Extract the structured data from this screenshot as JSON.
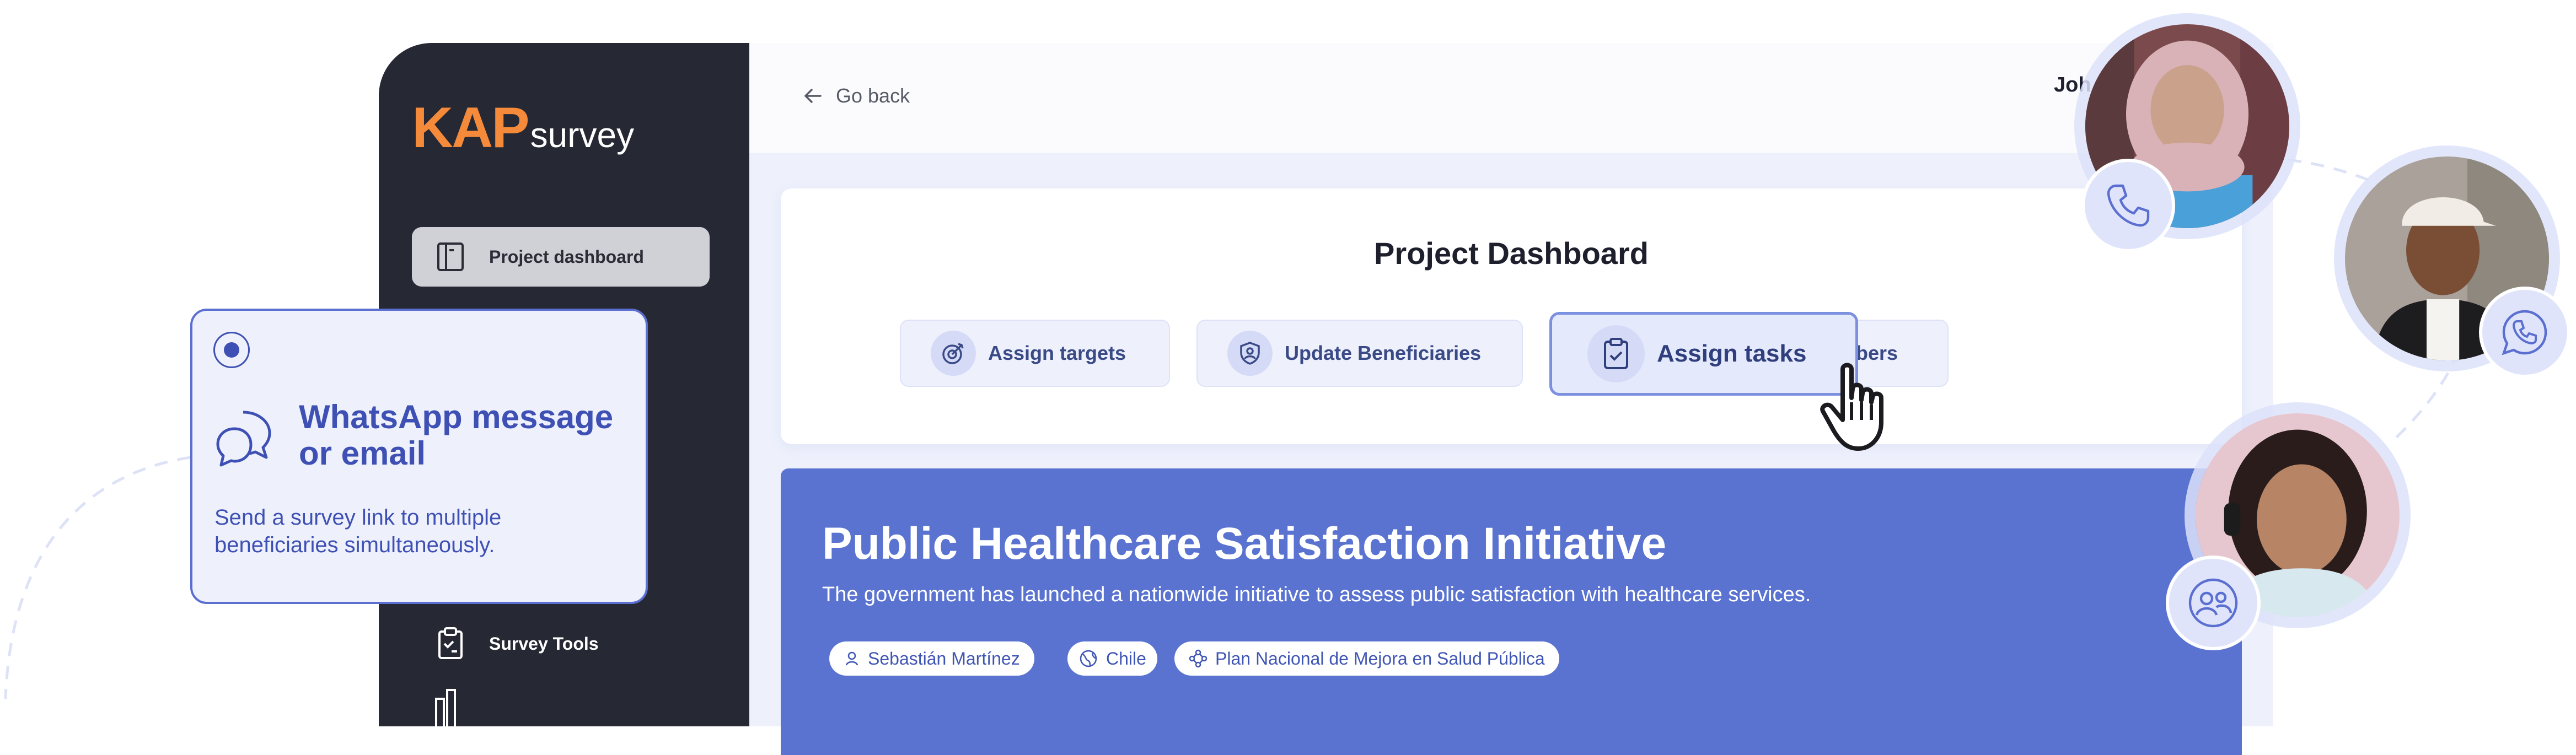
{
  "brand": {
    "kap": "KAP",
    "survey": "survey"
  },
  "sidebar": {
    "items": [
      {
        "label": "Project dashboard",
        "icon": "notebook-icon",
        "active": true
      },
      {
        "label": "Survey Tools",
        "icon": "clipboard-icon",
        "active": false
      }
    ]
  },
  "topbar": {
    "go_back": "Go back",
    "user": "Joh"
  },
  "dashboard": {
    "title": "Project Dashboard",
    "actions": [
      {
        "label": "Assign targets",
        "icon": "target-icon"
      },
      {
        "label": "Update Beneficiaries",
        "icon": "shield-user-icon"
      },
      {
        "label": "Assign tasks",
        "icon": "clipboard-check-icon",
        "highlighted": true
      },
      {
        "label": "Update Members",
        "icon": "refresh-icon"
      }
    ]
  },
  "project": {
    "title": "Public Healthcare Satisfaction Initiative",
    "description": "The government has launched a nationwide initiative to assess public satisfaction with healthcare services.",
    "tags": [
      {
        "label": "Sebastián Martínez",
        "icon": "user-icon"
      },
      {
        "label": "Chile",
        "icon": "globe-icon"
      },
      {
        "label": "Plan Nacional de Mejora en Salud Pública",
        "icon": "network-icon"
      }
    ]
  },
  "popup": {
    "title": "WhatsApp message or email",
    "description": "Send a survey link to multiple beneficiaries simultaneously."
  },
  "colors": {
    "accent": "#5a73d0",
    "brand_orange": "#f58a3a",
    "sidebar": "#262833",
    "popup_text": "#3e50b3"
  },
  "avatars": [
    {
      "icon": "phone-icon"
    },
    {
      "icon": "whatsapp-icon"
    },
    {
      "icon": "users-icon"
    }
  ]
}
